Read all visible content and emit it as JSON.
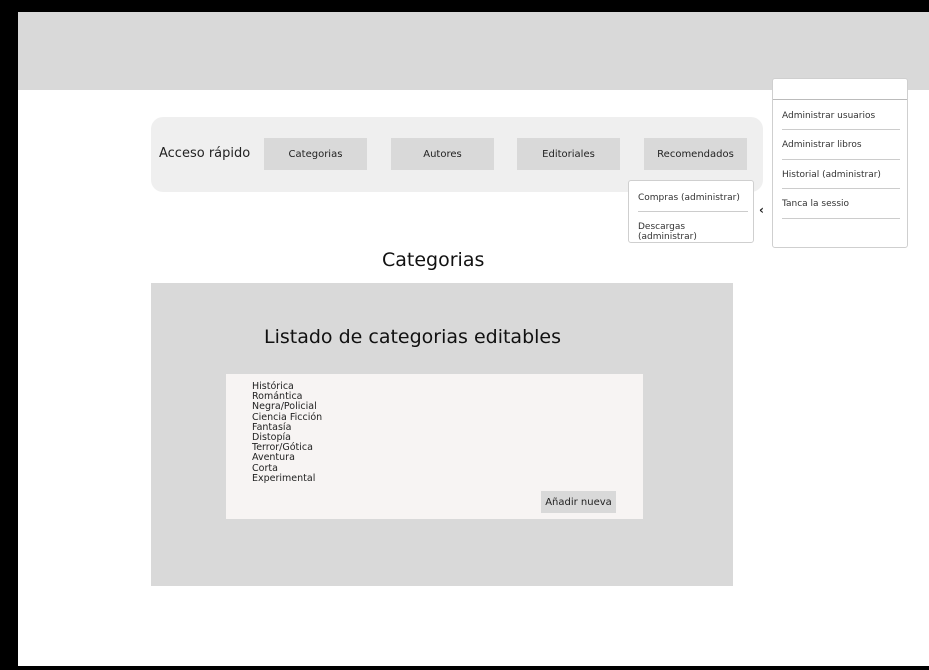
{
  "quick_access": {
    "label": "Acceso rápido",
    "buttons": [
      "Categorias",
      "Autores",
      "Editoriales",
      "Recomendados"
    ]
  },
  "purchases_dropdown": {
    "items": [
      "Compras (administrar)",
      "Descargas (administrar)"
    ]
  },
  "user_menu": {
    "items": [
      "Administrar usuarios",
      "Administrar libros",
      "Historial (administrar)",
      "Tanca la sessio"
    ]
  },
  "section_title": "Categorias",
  "categories_panel": {
    "title": "Listado de categorias editables",
    "items": [
      "Histórica",
      "Romántica",
      "Negra/Policial",
      "Ciencia Ficción",
      "Fantasía",
      "Distopía",
      "Terror/Gótica",
      "Aventura",
      "Corta",
      "Experimental"
    ],
    "add_button": "Añadir nueva"
  }
}
